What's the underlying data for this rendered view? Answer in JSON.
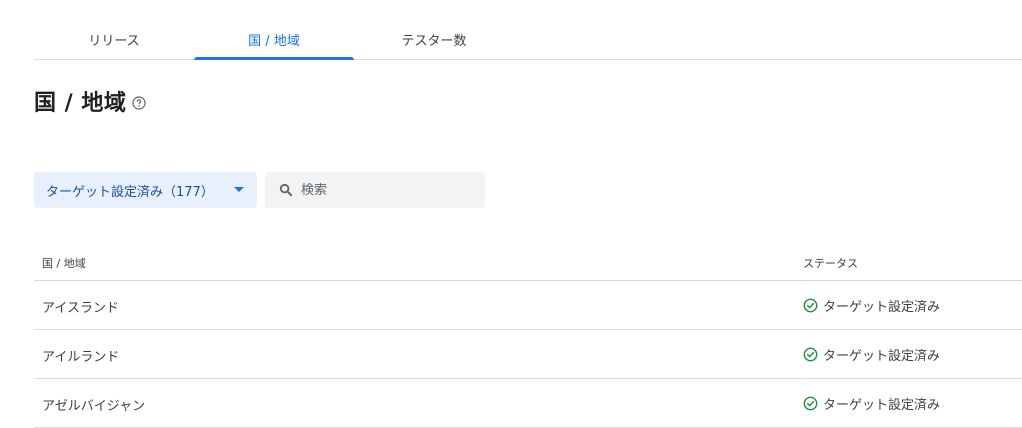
{
  "tabs": [
    {
      "label": "リリース",
      "active": false
    },
    {
      "label": "国 / 地域",
      "active": true
    },
    {
      "label": "テスター数",
      "active": false
    }
  ],
  "page": {
    "title": "国 / 地域",
    "help_icon": "help-circle-icon"
  },
  "filter": {
    "label": "ターゲット設定済み（177）",
    "icon": "dropdown-arrow-icon"
  },
  "search": {
    "placeholder": "検索",
    "value": "",
    "icon": "search-icon"
  },
  "table": {
    "columns": [
      "国 / 地域",
      "ステータス"
    ],
    "rows": [
      {
        "country": "アイスランド",
        "status": "ターゲット設定済み"
      },
      {
        "country": "アイルランド",
        "status": "ターゲット設定済み"
      },
      {
        "country": "アゼルバイジャン",
        "status": "ターゲット設定済み"
      }
    ],
    "status_icon": "check-circle-icon"
  },
  "colors": {
    "accent": "#1a73e8",
    "chip_bg": "#e8f0fe",
    "status_ok": "#1e8e3e"
  }
}
